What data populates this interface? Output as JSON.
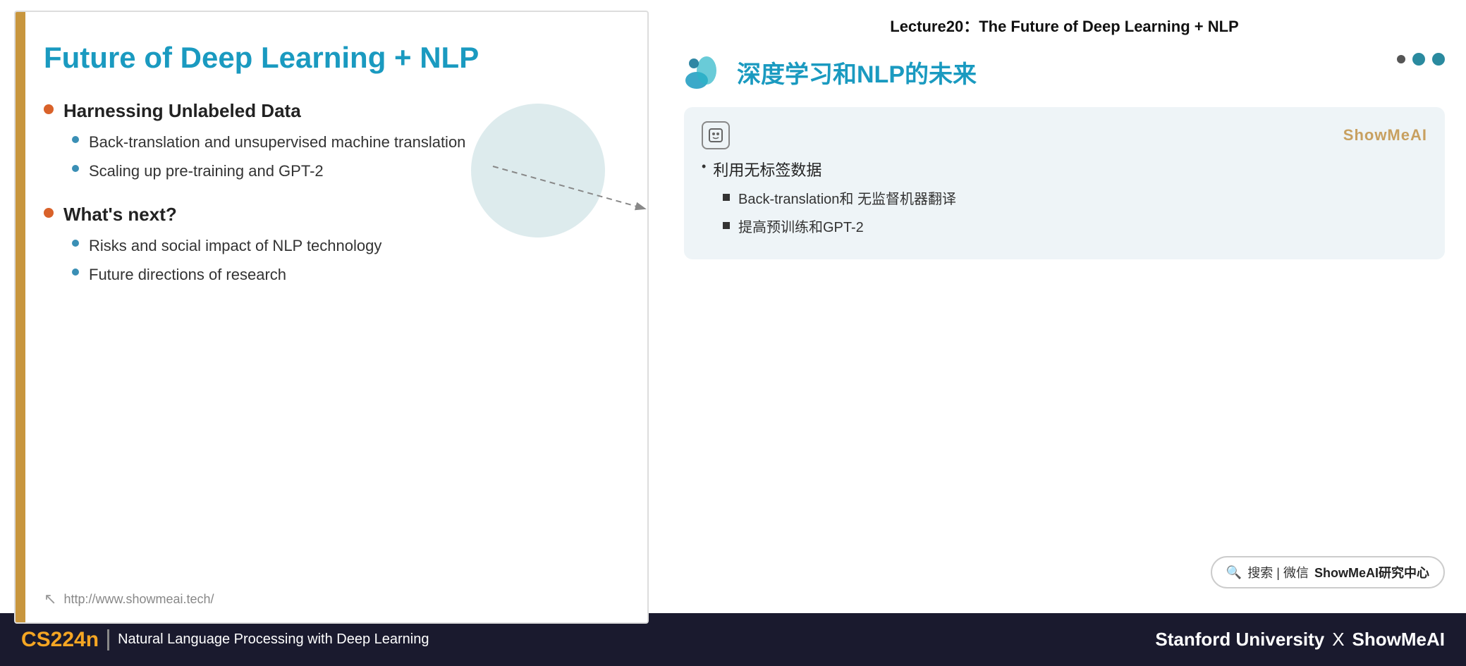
{
  "header": {
    "lecture_title": "Lecture20：The Future of Deep Learning + NLP"
  },
  "slide": {
    "title": "Future of Deep Learning + NLP",
    "left_bar_color": "#c8963e",
    "sections": [
      {
        "main_bullet": "Harnessing Unlabeled Data",
        "sub_bullets": [
          "Back-translation and unsupervised machine translation",
          "Scaling up pre-training and GPT-2"
        ]
      },
      {
        "main_bullet": "What's next?",
        "sub_bullets": [
          "Risks and social impact of NLP technology",
          "Future directions of research"
        ]
      }
    ],
    "footer_url": "http://www.showmeai.tech/"
  },
  "right_panel": {
    "cn_title": "深度学习和NLP的未来",
    "nav_dots": [
      "filled",
      "filled",
      "filled"
    ],
    "ai_card": {
      "brand": "ShowMeAI",
      "bullet_main": "利用无标签数据",
      "sub_bullets": [
        "Back-translation和 无监督机器翻译",
        "提高预训练和GPT-2"
      ]
    },
    "search": {
      "icon": "🔍",
      "text": "搜索 | 微信",
      "label": "ShowMeAI研究中心"
    }
  },
  "bottom_bar": {
    "course_code": "CS224n",
    "divider": "|",
    "course_name": "Natural Language Processing with Deep Learning",
    "university": "Stanford University",
    "x": "X",
    "brand": "ShowMeAI"
  }
}
